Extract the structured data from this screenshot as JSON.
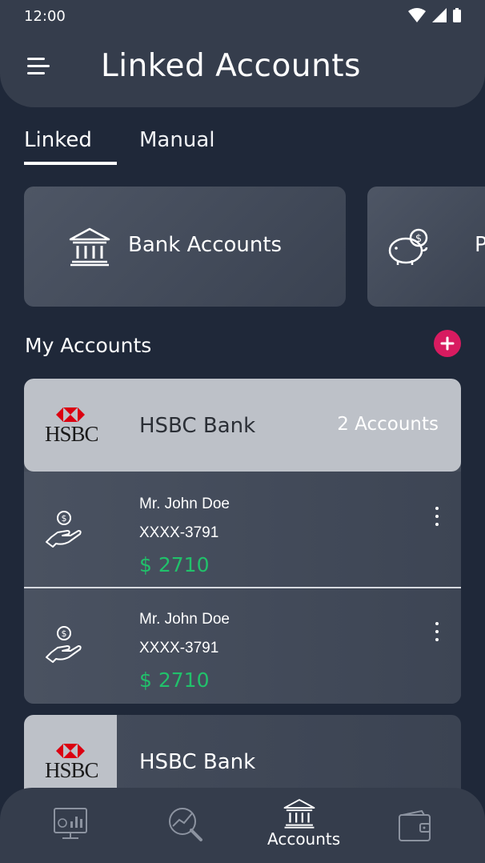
{
  "status_bar": {
    "time": "12:00"
  },
  "header": {
    "title": "Linked Accounts"
  },
  "tabs": [
    {
      "label": "Linked",
      "active": true
    },
    {
      "label": "Manual",
      "active": false
    }
  ],
  "categories": [
    {
      "label": "Bank Accounts",
      "icon": "bank-icon"
    },
    {
      "label": "P",
      "icon": "piggy-bank-icon"
    }
  ],
  "section": {
    "title": "My Accounts"
  },
  "banks": [
    {
      "logo_text": "HSBC",
      "name": "HSBC Bank",
      "count": "2 Accounts",
      "accounts": [
        {
          "holder": "Mr. John Doe",
          "number": "XXXX-3791",
          "amount": "$ 2710"
        },
        {
          "holder": "Mr. John Doe",
          "number": "XXXX-3791",
          "amount": "$ 2710"
        }
      ]
    },
    {
      "logo_text": "HSBC",
      "name": "HSBC Bank"
    }
  ],
  "bottom_nav": {
    "items": [
      {
        "icon": "dashboard-icon"
      },
      {
        "icon": "analytics-search-icon"
      },
      {
        "icon": "bank-icon",
        "label": "Accounts",
        "active": true
      },
      {
        "icon": "wallet-icon"
      }
    ]
  },
  "colors": {
    "accent_add": "#d81b60",
    "amount_green": "#21c16b",
    "background": "#1f2839"
  }
}
